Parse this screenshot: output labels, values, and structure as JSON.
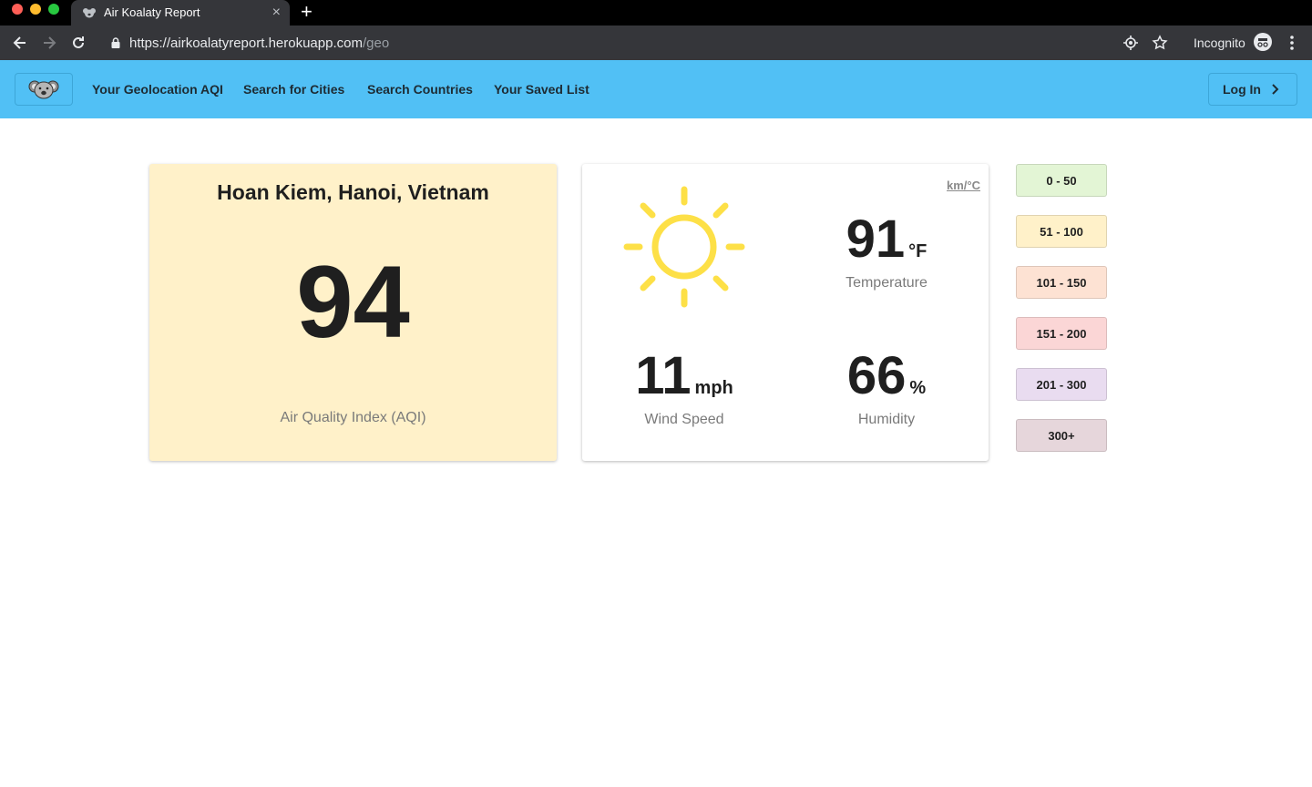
{
  "browser": {
    "tab_title": "Air Koalaty Report",
    "new_tab_symbol": "+",
    "close_symbol": "×",
    "url_main": "https://airkoalatyreport.herokuapp.com",
    "url_path": "/geo",
    "incognito_label": "Incognito"
  },
  "nav": {
    "items": [
      "Your Geolocation AQI",
      "Search for Cities",
      "Search Countries",
      "Your Saved List"
    ],
    "login_label": "Log In"
  },
  "aqi": {
    "location": "Hoan Kiem, Hanoi, Vietnam",
    "value": "94",
    "caption": "Air Quality Index (AQI)",
    "background_color": "#fff1c9"
  },
  "weather": {
    "unit_toggle": "km/°C",
    "icon": "sun-icon",
    "temperature": {
      "value": "91",
      "unit": "°F",
      "label": "Temperature"
    },
    "wind": {
      "value": "11",
      "unit": "mph",
      "label": "Wind Speed"
    },
    "humidity": {
      "value": "66",
      "unit": "%",
      "label": "Humidity"
    }
  },
  "legend": [
    {
      "label": "0 - 50",
      "color": "#e3f5d5"
    },
    {
      "label": "51 - 100",
      "color": "#fff1c9"
    },
    {
      "label": "101 - 150",
      "color": "#fde2d3"
    },
    {
      "label": "151 - 200",
      "color": "#fbd6d6"
    },
    {
      "label": "201 - 300",
      "color": "#e9dcf0"
    },
    {
      "label": "300+",
      "color": "#e6d6db"
    }
  ],
  "colors": {
    "nav_bg": "#51c0f5",
    "sun": "#fde047"
  }
}
